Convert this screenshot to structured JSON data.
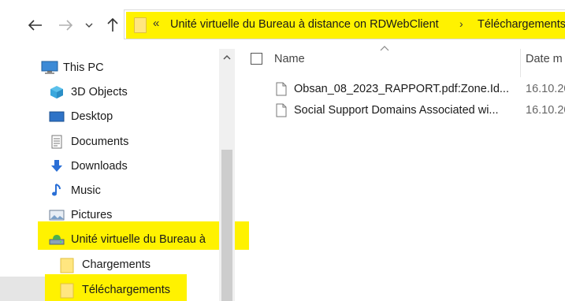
{
  "address_bar": {
    "overflow_chevron": "«",
    "segment_1": "Unité virtuelle du Bureau à distance on RDWebClient",
    "separator": "›",
    "segment_2": "Téléchargements"
  },
  "sidebar": {
    "items": [
      {
        "label": "This PC",
        "icon": "computer-icon"
      },
      {
        "label": "3D Objects",
        "icon": "cube-icon"
      },
      {
        "label": "Desktop",
        "icon": "desktop-icon"
      },
      {
        "label": "Documents",
        "icon": "document-icon"
      },
      {
        "label": "Downloads",
        "icon": "download-arrow-icon"
      },
      {
        "label": "Music",
        "icon": "music-note-icon"
      },
      {
        "label": "Pictures",
        "icon": "pictures-icon"
      },
      {
        "label": "Unité virtuelle du Bureau à",
        "icon": "network-drive-icon"
      },
      {
        "label": "Chargements",
        "icon": "folder-icon"
      },
      {
        "label": "Téléchargements",
        "icon": "folder-icon"
      }
    ]
  },
  "file_list": {
    "columns": {
      "name": "Name",
      "date": "Date m"
    },
    "rows": [
      {
        "name": "Obsan_08_2023_RAPPORT.pdf:Zone.Id...",
        "date": "16.10.20"
      },
      {
        "name": "Social Support Domains Associated wi...",
        "date": "16.10.20"
      }
    ]
  },
  "colors": {
    "highlight": "#fff200",
    "folder": "#ffe680",
    "selection": "#cce8ff"
  }
}
